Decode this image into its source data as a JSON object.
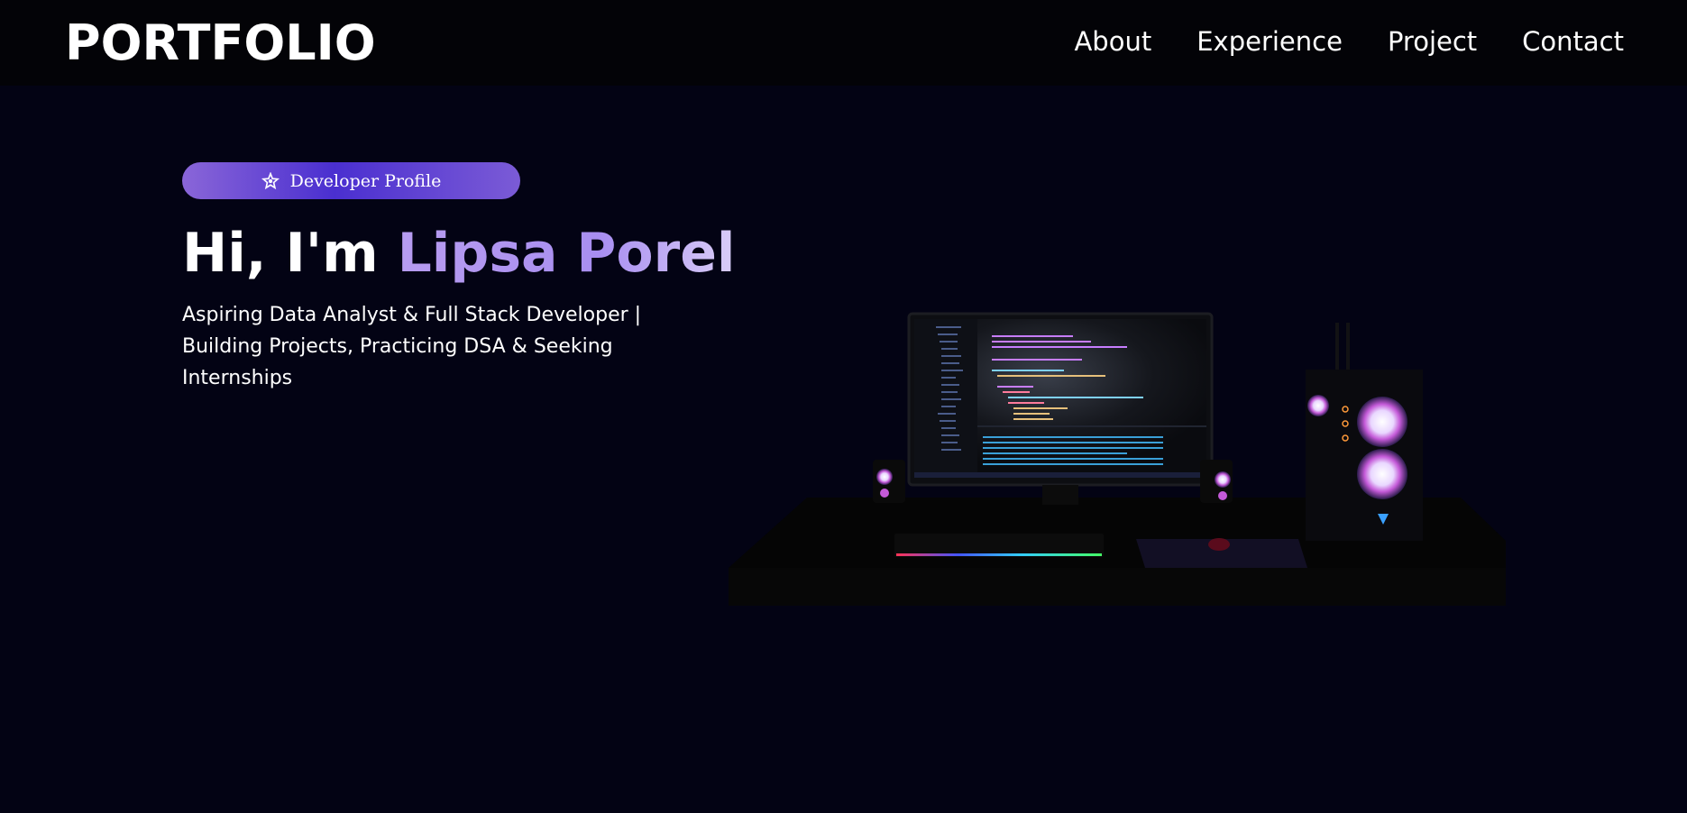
{
  "nav": {
    "logo": "PORTFOLIO",
    "links": [
      "About",
      "Experience",
      "Project",
      "Contact"
    ]
  },
  "hero": {
    "badge": "Developer Profile",
    "greeting": "Hi, I'm ",
    "name": "Lipsa Porel",
    "subtitle": "Aspiring Data Analyst & Full Stack Developer | Building Projects, Practicing DSA & Seeking Internships"
  },
  "icons": {
    "badge_icon": "star-icon"
  },
  "colors": {
    "background": "#030314",
    "navbar": "#030307",
    "accent": "#8a66d8",
    "name_gradient": "#b79cf0"
  }
}
